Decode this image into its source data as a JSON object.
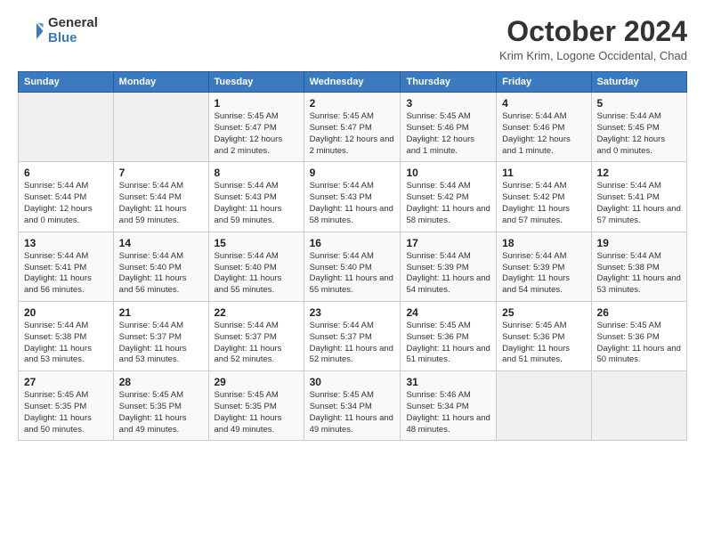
{
  "header": {
    "logo_general": "General",
    "logo_blue": "Blue",
    "month_title": "October 2024",
    "location": "Krim Krim, Logone Occidental, Chad"
  },
  "days_of_week": [
    "Sunday",
    "Monday",
    "Tuesday",
    "Wednesday",
    "Thursday",
    "Friday",
    "Saturday"
  ],
  "weeks": [
    [
      {
        "day": "",
        "info": ""
      },
      {
        "day": "",
        "info": ""
      },
      {
        "day": "1",
        "info": "Sunrise: 5:45 AM\nSunset: 5:47 PM\nDaylight: 12 hours and 2 minutes."
      },
      {
        "day": "2",
        "info": "Sunrise: 5:45 AM\nSunset: 5:47 PM\nDaylight: 12 hours and 2 minutes."
      },
      {
        "day": "3",
        "info": "Sunrise: 5:45 AM\nSunset: 5:46 PM\nDaylight: 12 hours and 1 minute."
      },
      {
        "day": "4",
        "info": "Sunrise: 5:44 AM\nSunset: 5:46 PM\nDaylight: 12 hours and 1 minute."
      },
      {
        "day": "5",
        "info": "Sunrise: 5:44 AM\nSunset: 5:45 PM\nDaylight: 12 hours and 0 minutes."
      }
    ],
    [
      {
        "day": "6",
        "info": "Sunrise: 5:44 AM\nSunset: 5:44 PM\nDaylight: 12 hours and 0 minutes."
      },
      {
        "day": "7",
        "info": "Sunrise: 5:44 AM\nSunset: 5:44 PM\nDaylight: 11 hours and 59 minutes."
      },
      {
        "day": "8",
        "info": "Sunrise: 5:44 AM\nSunset: 5:43 PM\nDaylight: 11 hours and 59 minutes."
      },
      {
        "day": "9",
        "info": "Sunrise: 5:44 AM\nSunset: 5:43 PM\nDaylight: 11 hours and 58 minutes."
      },
      {
        "day": "10",
        "info": "Sunrise: 5:44 AM\nSunset: 5:42 PM\nDaylight: 11 hours and 58 minutes."
      },
      {
        "day": "11",
        "info": "Sunrise: 5:44 AM\nSunset: 5:42 PM\nDaylight: 11 hours and 57 minutes."
      },
      {
        "day": "12",
        "info": "Sunrise: 5:44 AM\nSunset: 5:41 PM\nDaylight: 11 hours and 57 minutes."
      }
    ],
    [
      {
        "day": "13",
        "info": "Sunrise: 5:44 AM\nSunset: 5:41 PM\nDaylight: 11 hours and 56 minutes."
      },
      {
        "day": "14",
        "info": "Sunrise: 5:44 AM\nSunset: 5:40 PM\nDaylight: 11 hours and 56 minutes."
      },
      {
        "day": "15",
        "info": "Sunrise: 5:44 AM\nSunset: 5:40 PM\nDaylight: 11 hours and 55 minutes."
      },
      {
        "day": "16",
        "info": "Sunrise: 5:44 AM\nSunset: 5:40 PM\nDaylight: 11 hours and 55 minutes."
      },
      {
        "day": "17",
        "info": "Sunrise: 5:44 AM\nSunset: 5:39 PM\nDaylight: 11 hours and 54 minutes."
      },
      {
        "day": "18",
        "info": "Sunrise: 5:44 AM\nSunset: 5:39 PM\nDaylight: 11 hours and 54 minutes."
      },
      {
        "day": "19",
        "info": "Sunrise: 5:44 AM\nSunset: 5:38 PM\nDaylight: 11 hours and 53 minutes."
      }
    ],
    [
      {
        "day": "20",
        "info": "Sunrise: 5:44 AM\nSunset: 5:38 PM\nDaylight: 11 hours and 53 minutes."
      },
      {
        "day": "21",
        "info": "Sunrise: 5:44 AM\nSunset: 5:37 PM\nDaylight: 11 hours and 53 minutes."
      },
      {
        "day": "22",
        "info": "Sunrise: 5:44 AM\nSunset: 5:37 PM\nDaylight: 11 hours and 52 minutes."
      },
      {
        "day": "23",
        "info": "Sunrise: 5:44 AM\nSunset: 5:37 PM\nDaylight: 11 hours and 52 minutes."
      },
      {
        "day": "24",
        "info": "Sunrise: 5:45 AM\nSunset: 5:36 PM\nDaylight: 11 hours and 51 minutes."
      },
      {
        "day": "25",
        "info": "Sunrise: 5:45 AM\nSunset: 5:36 PM\nDaylight: 11 hours and 51 minutes."
      },
      {
        "day": "26",
        "info": "Sunrise: 5:45 AM\nSunset: 5:36 PM\nDaylight: 11 hours and 50 minutes."
      }
    ],
    [
      {
        "day": "27",
        "info": "Sunrise: 5:45 AM\nSunset: 5:35 PM\nDaylight: 11 hours and 50 minutes."
      },
      {
        "day": "28",
        "info": "Sunrise: 5:45 AM\nSunset: 5:35 PM\nDaylight: 11 hours and 49 minutes."
      },
      {
        "day": "29",
        "info": "Sunrise: 5:45 AM\nSunset: 5:35 PM\nDaylight: 11 hours and 49 minutes."
      },
      {
        "day": "30",
        "info": "Sunrise: 5:45 AM\nSunset: 5:34 PM\nDaylight: 11 hours and 49 minutes."
      },
      {
        "day": "31",
        "info": "Sunrise: 5:46 AM\nSunset: 5:34 PM\nDaylight: 11 hours and 48 minutes."
      },
      {
        "day": "",
        "info": ""
      },
      {
        "day": "",
        "info": ""
      }
    ]
  ]
}
